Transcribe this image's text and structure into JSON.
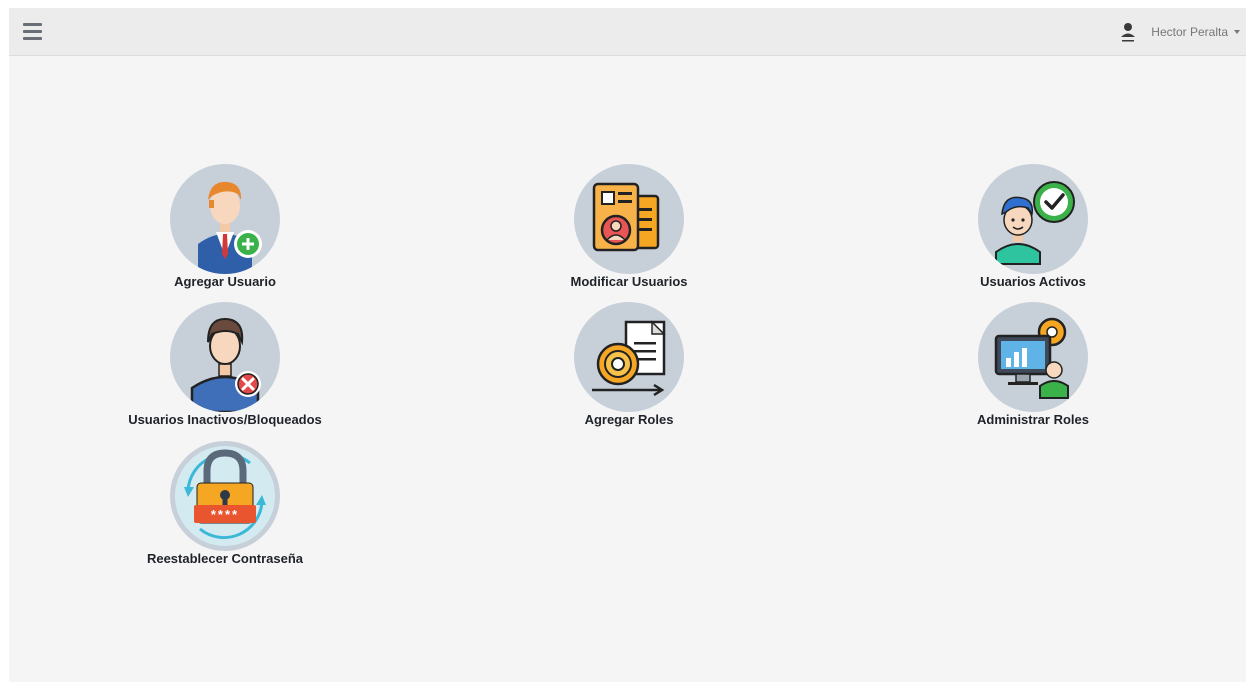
{
  "header": {
    "menu_icon": "hamburger-menu-icon",
    "user_icon": "user-avatar-icon",
    "user_name": "Hector Peralta"
  },
  "tiles": [
    {
      "label": "Agregar Usuario",
      "icon": "add-user-icon"
    },
    {
      "label": "Modificar Usuarios",
      "icon": "edit-users-icon"
    },
    {
      "label": "Usuarios Activos",
      "icon": "active-users-icon"
    },
    {
      "label": "Usuarios Inactivos/Bloqueados",
      "icon": "blocked-user-icon"
    },
    {
      "label": "Agregar Roles",
      "icon": "add-roles-icon"
    },
    {
      "label": "Administrar Roles",
      "icon": "manage-roles-icon"
    },
    {
      "label": "Reestablecer Contraseña",
      "icon": "reset-password-icon",
      "password_mask": "****"
    }
  ],
  "colors": {
    "circle_bg": "#c7d0d9",
    "header_bg": "#ececec",
    "page_bg": "#f5f5f5"
  }
}
